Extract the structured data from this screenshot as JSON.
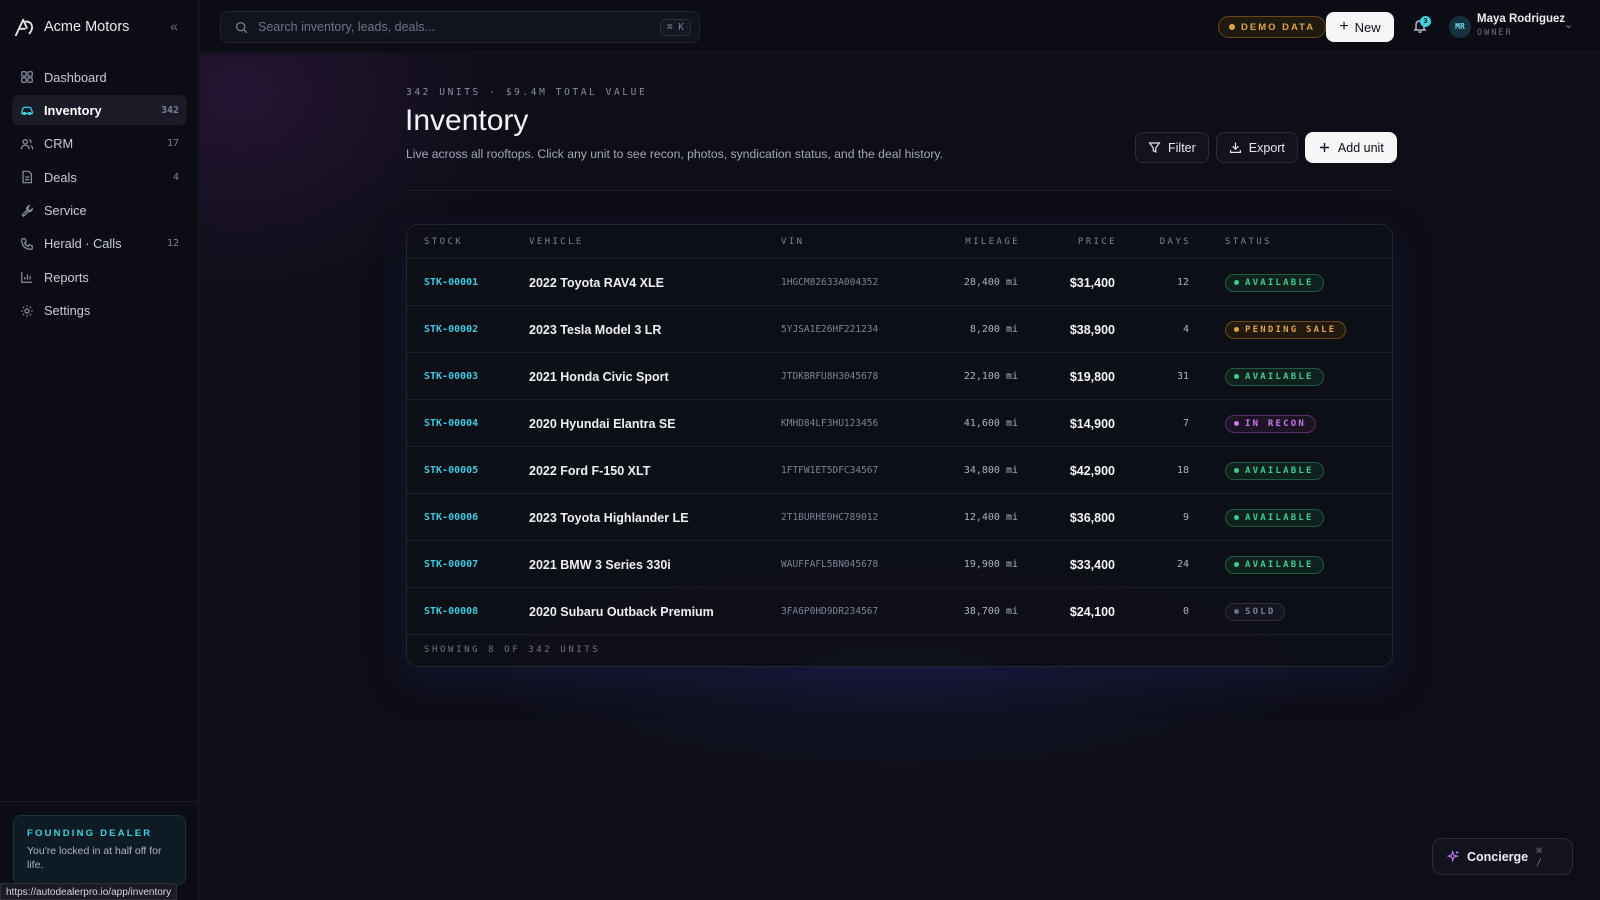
{
  "brand": {
    "name": "Acme Motors"
  },
  "sidebar": {
    "items": [
      {
        "label": "Dashboard",
        "count": ""
      },
      {
        "label": "Inventory",
        "count": "342"
      },
      {
        "label": "CRM",
        "count": "17"
      },
      {
        "label": "Deals",
        "count": "4"
      },
      {
        "label": "Service",
        "count": ""
      },
      {
        "label": "Herald · Calls",
        "count": "12"
      },
      {
        "label": "Reports",
        "count": ""
      },
      {
        "label": "Settings",
        "count": ""
      }
    ],
    "active": "Inventory",
    "founder": {
      "title": "FOUNDING DEALER",
      "text": "You're locked in at half off for life."
    },
    "status_url": "https://autodealerpro.io/app/inventory"
  },
  "topbar": {
    "search_placeholder": "Search inventory, leads, deals...",
    "search_shortcut": "⌘ K",
    "demo_badge": "DEMO DATA",
    "new_label": "New",
    "notifications_count": "3",
    "user": {
      "initials": "MR",
      "name": "Maya Rodriguez",
      "role": "OWNER"
    }
  },
  "page": {
    "eyebrow": "342 UNITS · $9.4M TOTAL VALUE",
    "title": "Inventory",
    "subtitle": "Live across all rooftops. Click any unit to see recon, photos, syndication status, and the deal history.",
    "actions": {
      "filter": "Filter",
      "export": "Export",
      "add_unit": "Add unit"
    }
  },
  "table": {
    "columns": {
      "stock": "STOCK",
      "vehicle": "VEHICLE",
      "vin": "VIN",
      "mileage": "MILEAGE",
      "price": "PRICE",
      "days": "DAYS",
      "status": "STATUS"
    },
    "rows": [
      {
        "stock": "STK-00001",
        "vehicle": "2022 Toyota RAV4 XLE",
        "vin": "1HGCM82633A004352",
        "mileage": "28,400 mi",
        "price": "$31,400",
        "days": "12",
        "status": "AVAILABLE",
        "status_type": "available"
      },
      {
        "stock": "STK-00002",
        "vehicle": "2023 Tesla Model 3 LR",
        "vin": "5YJSA1E26HF221234",
        "mileage": "8,200 mi",
        "price": "$38,900",
        "days": "4",
        "status": "PENDING SALE",
        "status_type": "pending"
      },
      {
        "stock": "STK-00003",
        "vehicle": "2021 Honda Civic Sport",
        "vin": "JTDKBRFU8H3045678",
        "mileage": "22,100 mi",
        "price": "$19,800",
        "days": "31",
        "status": "AVAILABLE",
        "status_type": "available"
      },
      {
        "stock": "STK-00004",
        "vehicle": "2020 Hyundai Elantra SE",
        "vin": "KMHD84LF3HU123456",
        "mileage": "41,600 mi",
        "price": "$14,900",
        "days": "7",
        "status": "IN RECON",
        "status_type": "recon"
      },
      {
        "stock": "STK-00005",
        "vehicle": "2022 Ford F-150 XLT",
        "vin": "1FTFW1ET5DFC34567",
        "mileage": "34,800 mi",
        "price": "$42,900",
        "days": "18",
        "status": "AVAILABLE",
        "status_type": "available"
      },
      {
        "stock": "STK-00006",
        "vehicle": "2023 Toyota Highlander LE",
        "vin": "2T1BURHE0HC789012",
        "mileage": "12,400 mi",
        "price": "$36,800",
        "days": "9",
        "status": "AVAILABLE",
        "status_type": "available"
      },
      {
        "stock": "STK-00007",
        "vehicle": "2021 BMW 3 Series 330i",
        "vin": "WAUFFAFL5BN045678",
        "mileage": "19,900 mi",
        "price": "$33,400",
        "days": "24",
        "status": "AVAILABLE",
        "status_type": "available"
      },
      {
        "stock": "STK-00008",
        "vehicle": "2020 Subaru Outback Premium",
        "vin": "3FA6P0HD9DR234567",
        "mileage": "38,700 mi",
        "price": "$24,100",
        "days": "0",
        "status": "SOLD",
        "status_type": "sold"
      }
    ],
    "footer": "SHOWING 8 OF 342 UNITS"
  },
  "concierge": {
    "label": "Concierge",
    "shortcut": "⌘ /"
  },
  "colors": {
    "accent": "#3fd1e0",
    "available": "#3ecb8e",
    "pending": "#e0a447",
    "recon": "#c87ae8",
    "sold": "#7d8195"
  },
  "icons": {
    "sidebar": [
      "grid-icon",
      "car-icon",
      "users-icon",
      "document-icon",
      "wrench-icon",
      "phone-icon",
      "bar-chart-icon",
      "gear-icon"
    ]
  }
}
